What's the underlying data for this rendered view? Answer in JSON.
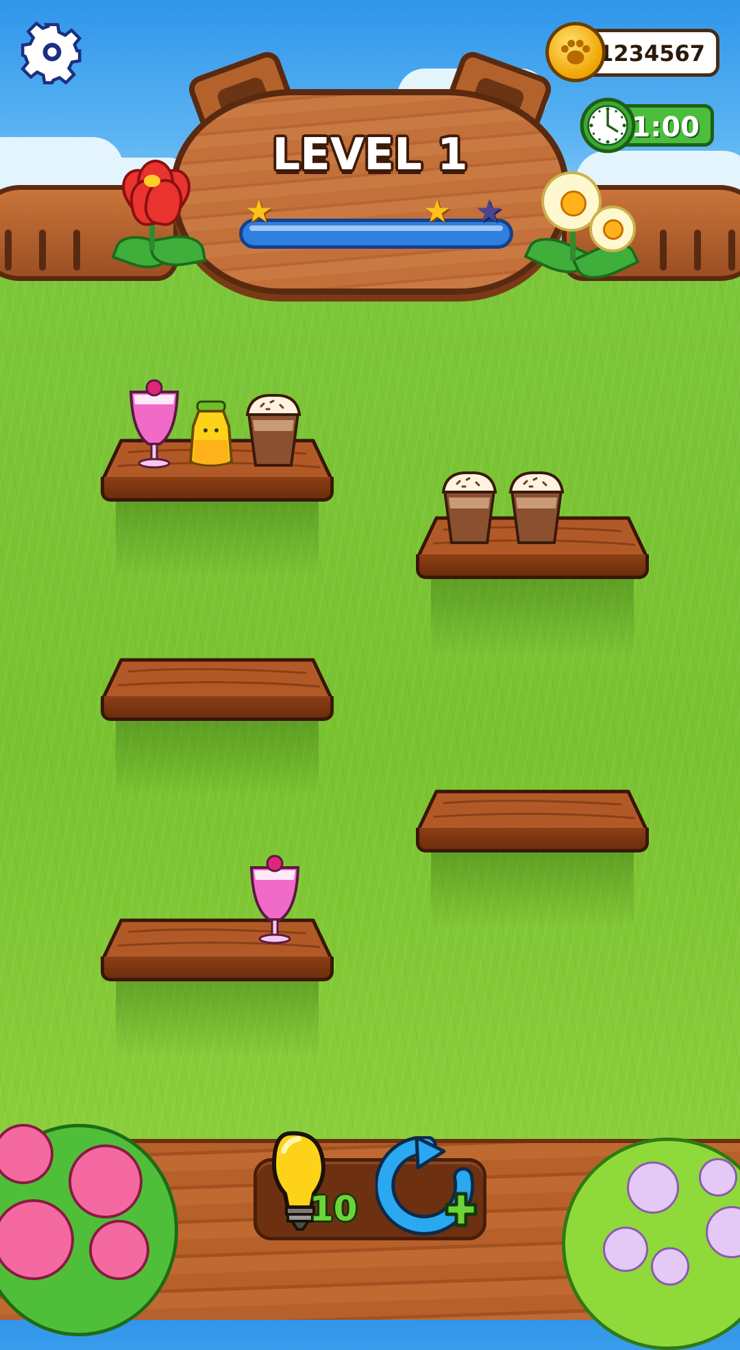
{
  "header": {
    "level_title": "LEVEL 1",
    "coins": "1234567",
    "timer": "1:00",
    "progress_fraction": 0.0,
    "stars": [
      true,
      true,
      false
    ]
  },
  "boosters": {
    "hint_count": "10"
  },
  "shelves": [
    {
      "name": "shelf-1",
      "items": [
        "pink-smoothie",
        "yellow-juice",
        "chocolate-latte"
      ]
    },
    {
      "name": "shelf-2",
      "items": [
        "chocolate-latte",
        "chocolate-latte"
      ]
    },
    {
      "name": "shelf-3",
      "items": []
    },
    {
      "name": "shelf-4",
      "items": []
    },
    {
      "name": "shelf-5",
      "items": [
        "pink-smoothie"
      ]
    }
  ],
  "colors": {
    "grass": "#79c230",
    "wood": "#b4622c",
    "wood_outline": "#5a2a10",
    "progress_blue": "#3a8ff0",
    "star_gold": "#ffc21a",
    "coin_gold": "#f0a400",
    "timer_green": "#4bbe3d",
    "hint_green": "#6dd33a"
  }
}
